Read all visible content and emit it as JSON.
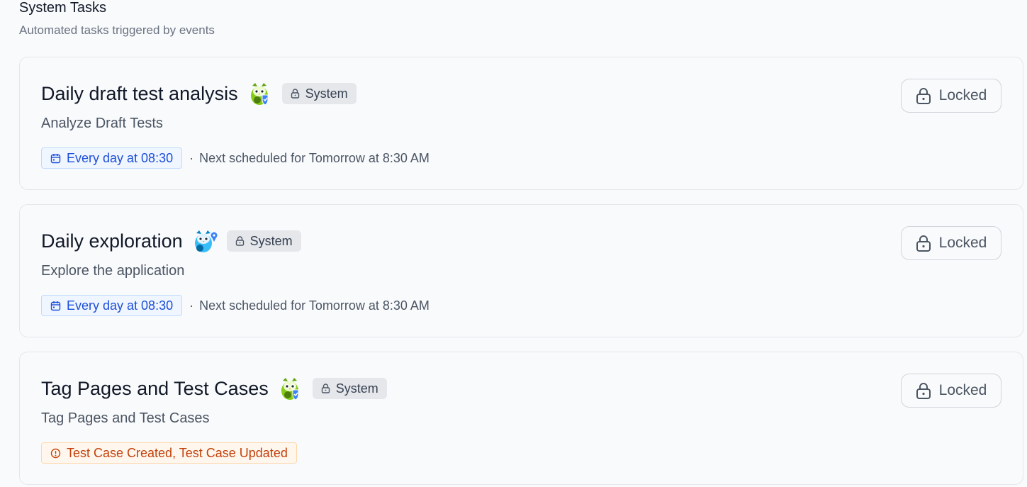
{
  "section": {
    "title": "System Tasks",
    "subtitle": "Automated tasks triggered by events"
  },
  "tasks": [
    {
      "title": "Daily draft test analysis",
      "agent_icon": "green-owl-shield-icon",
      "badge": "System",
      "description": "Analyze Draft Tests",
      "trigger_type": "schedule",
      "schedule": "Every day at 08:30",
      "next": "Next scheduled for Tomorrow at 8:30 AM",
      "action_label": "Locked"
    },
    {
      "title": "Daily exploration",
      "agent_icon": "blue-owl-pin-icon",
      "badge": "System",
      "description": "Explore the application",
      "trigger_type": "schedule",
      "schedule": "Every day at 08:30",
      "next": "Next scheduled for Tomorrow at 8:30 AM",
      "action_label": "Locked"
    },
    {
      "title": "Tag Pages and Test Cases",
      "agent_icon": "green-owl-shield-icon",
      "badge": "System",
      "description": "Tag Pages and Test Cases",
      "trigger_type": "event",
      "events": "Test Case Created, Test Case Updated",
      "action_label": "Locked"
    }
  ],
  "colors": {
    "schedule_accent": "#1d4ed8",
    "event_accent": "#c2410c",
    "badge_bg": "#e5e7eb"
  }
}
